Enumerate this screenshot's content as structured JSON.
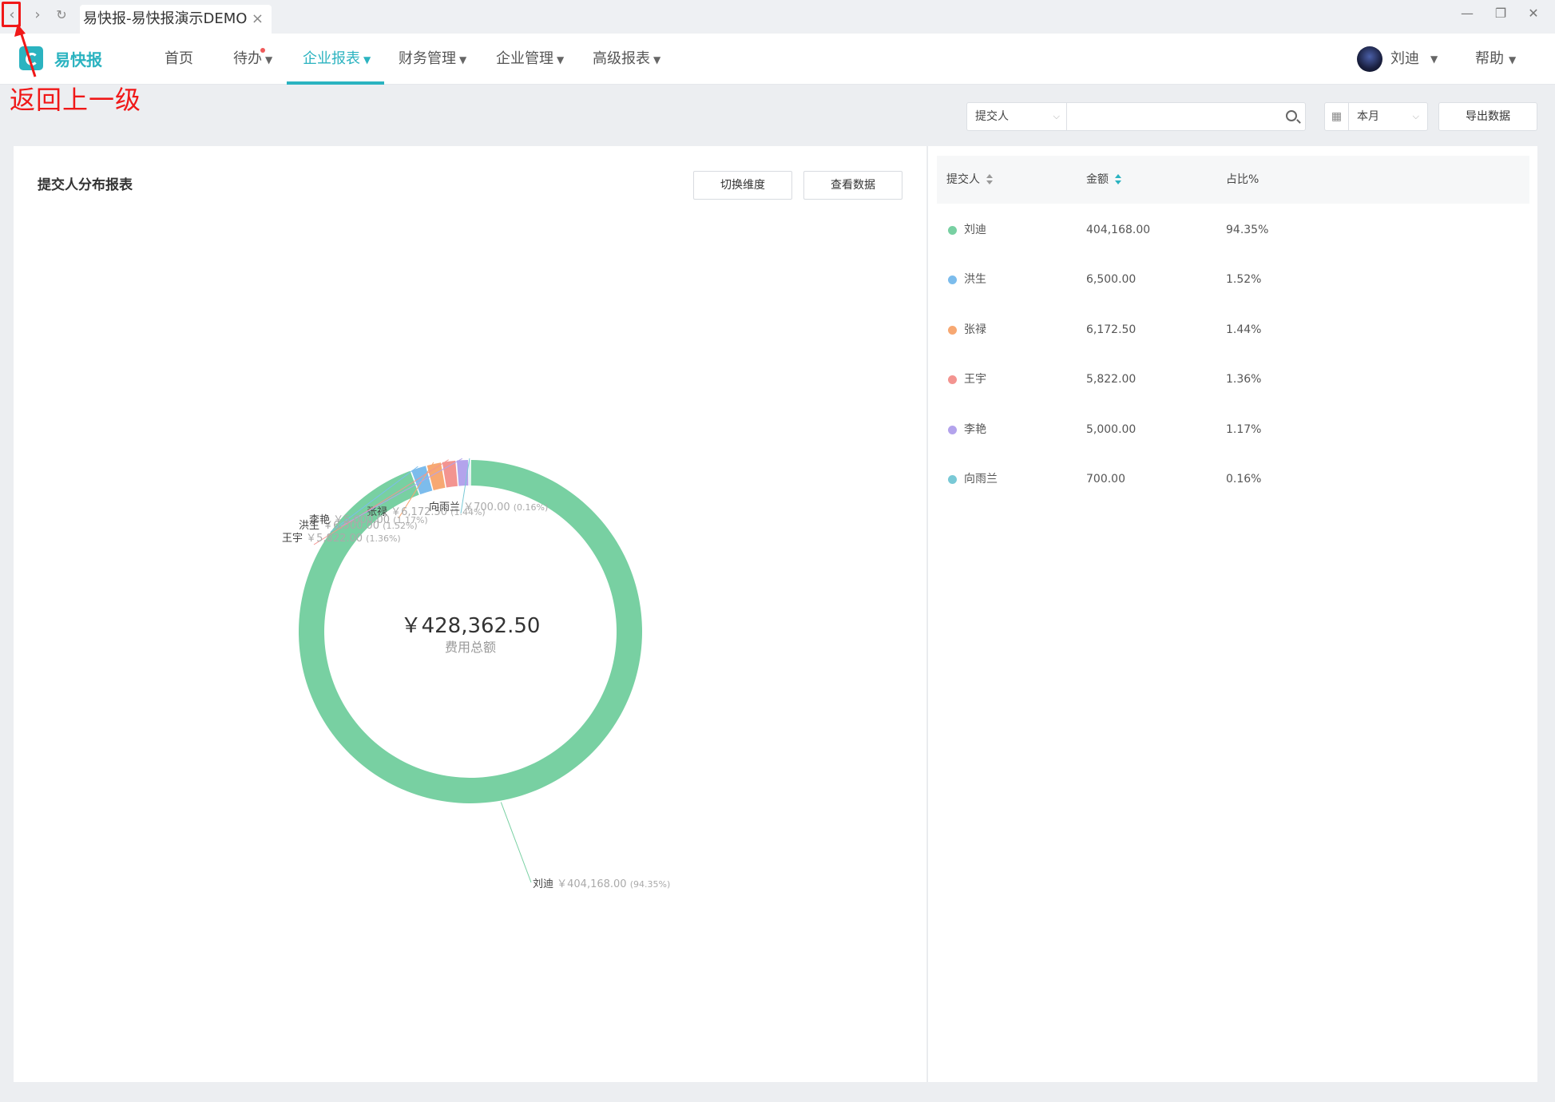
{
  "browser": {
    "tab_title": "易快报-易快报演示DEMO",
    "back_glyph": "‹",
    "forward_glyph": "›",
    "reload_glyph": "↻",
    "close_glyph": "×",
    "minimize_glyph": "—",
    "restore_glyph": "❐",
    "window_close_glyph": "✕"
  },
  "annotation": {
    "text": "返回上一级",
    "color": "#f01818"
  },
  "header": {
    "logo_text": "易快报",
    "menu": [
      {
        "label": "首页"
      },
      {
        "label": "待办",
        "has_dot": true
      },
      {
        "label": "企业报表",
        "active": true
      },
      {
        "label": "财务管理"
      },
      {
        "label": "企业管理"
      },
      {
        "label": "高级报表"
      }
    ],
    "caret": "▼",
    "user_name": "刘迪",
    "help": "帮助"
  },
  "filters": {
    "dimension": "提交人",
    "search_placeholder": "",
    "date_range": "本月",
    "export_label": "导出数据"
  },
  "report": {
    "title": "提交人分布报表",
    "switch_label": "切换维度",
    "view_data_label": "查看数据",
    "center_total": "￥428,362.50",
    "center_label": "费用总额"
  },
  "chart_data": {
    "type": "pie",
    "categories": [
      "刘迪",
      "洪生",
      "张禄",
      "王宇",
      "李艳",
      "向雨兰"
    ],
    "values": [
      404168.0,
      6500.0,
      6172.5,
      5822.0,
      5000.0,
      700.0
    ],
    "percent_labels": [
      "94.35%",
      "1.52%",
      "1.44%",
      "1.36%",
      "1.17%",
      "0.16%"
    ],
    "slice_labels": [
      {
        "name": "刘迪",
        "amount": "￥404,168.00",
        "pct": "(94.35%)"
      },
      {
        "name": "洪生",
        "amount": "￥6,500.00",
        "pct": "(1.52%)"
      },
      {
        "name": "张禄",
        "amount": "￥6,172.50",
        "pct": "(1.44%)"
      },
      {
        "name": "王宇",
        "amount": "￥5,822.00",
        "pct": "(1.36%)"
      },
      {
        "name": "李艳",
        "amount": "￥5,000.00",
        "pct": "(1.17%)"
      },
      {
        "name": "向雨兰",
        "amount": "￥700.00",
        "pct": "(0.16%)"
      }
    ],
    "colors": [
      "#78d0a2",
      "#7cbcec",
      "#f7a872",
      "#f39490",
      "#b3a3ec",
      "#79c9d6"
    ],
    "donut": true
  },
  "table": {
    "headers": [
      "提交人",
      "金额",
      "占比%"
    ],
    "rows": [
      {
        "name": "刘迪",
        "amount": "404,168.00",
        "pct": "94.35%",
        "color": "#78d0a2"
      },
      {
        "name": "洪生",
        "amount": "6,500.00",
        "pct": "1.52%",
        "color": "#7cbcec"
      },
      {
        "name": "张禄",
        "amount": "6,172.50",
        "pct": "1.44%",
        "color": "#f7a872"
      },
      {
        "name": "王宇",
        "amount": "5,822.00",
        "pct": "1.36%",
        "color": "#f39490"
      },
      {
        "name": "李艳",
        "amount": "5,000.00",
        "pct": "1.17%",
        "color": "#b3a3ec"
      },
      {
        "name": "向雨兰",
        "amount": "700.00",
        "pct": "0.16%",
        "color": "#79c9d6"
      }
    ]
  }
}
